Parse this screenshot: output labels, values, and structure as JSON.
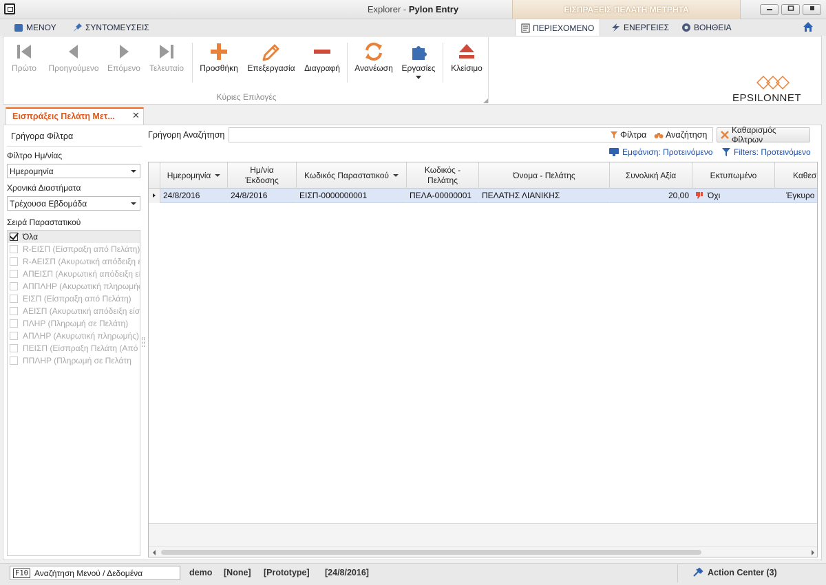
{
  "window": {
    "title_prefix": "Explorer - ",
    "title_app": "Pylon Entry",
    "context_title": "ΕΙΣΠΡΑΞΕΙΣ ΠΕΛΑΤΗ ΜΕΤΡΗΤΑ",
    "controls": [
      "minimize",
      "maximize",
      "close"
    ]
  },
  "menu": {
    "menu_label": "ΜΕΝΟΥ",
    "shortcuts_label": "ΣΥΝΤΟΜΕΥΣΕΙΣ",
    "tabs": {
      "content": "ΠΕΡΙΕΧΟΜΕΝΟ",
      "actions": "ΕΝΕΡΓΕΙΕΣ",
      "help": "ΒΟΗΘΕΙΑ"
    }
  },
  "ribbon": {
    "buttons": {
      "first": "Πρώτο",
      "previous": "Προηγούμενο",
      "next": "Επόμενο",
      "last": "Τελευταίο",
      "add": "Προσθήκη",
      "edit": "Επεξεργασία",
      "delete": "Διαγραφή",
      "refresh": "Ανανέωση",
      "tasks": "Εργασίες",
      "close": "Κλείσιμο"
    },
    "group_label": "Κύριες Επιλογές",
    "logo_text_a": "EPSILON",
    "logo_text_b": "NET",
    "accent": "#e8823a"
  },
  "doc_tab": {
    "label": "Εισπράξεις Πελάτη Μετ...",
    "close": "✕"
  },
  "left_panel": {
    "title": "Γρήγορα Φίλτρα",
    "date_filter_label": "Φίλτρο Ημ/νίας",
    "date_filter_value": "Ημερομηνία",
    "period_label": "Χρονικά Διαστήματα",
    "period_value": "Τρέχουσα Εβδομάδα",
    "series_label": "Σειρά Παραστατικού",
    "series": [
      "Όλα",
      "R-ΕΙΣΠ (Είσπραξη από Πελάτη)",
      "R-ΑΕΙΣΠ (Ακυρωτική απόδειξη είσπραξης)",
      "ΑΠΕΙΣΠ (Ακυρωτική απόδειξη είσπραξης)",
      "ΑΠΠΛΗΡ (Ακυρωτική πληρωμής)",
      "ΕΙΣΠ (Είσπραξη από Πελάτη)",
      "ΑΕΙΣΠ (Ακυρωτική απόδειξη είσπραξης)",
      "ΠΛΗΡ (Πληρωμή σε Πελάτη)",
      "ΑΠΛΗΡ (Ακυρωτική πληρωμής)",
      "ΠΕΙΣΠ (Είσπραξη Πελάτη (Από",
      "ΠΠΛΗΡ (Πληρωμή σε Πελάτη"
    ],
    "series_checked": [
      true,
      false,
      false,
      false,
      false,
      false,
      false,
      false,
      false,
      false,
      false
    ]
  },
  "search": {
    "label": "Γρήγορη Αναζήτηση",
    "value": "",
    "filters_label": "Φίλτρα",
    "search_label": "Αναζήτηση",
    "clear_label": "Καθαρισμός Φίλτρων",
    "view_label": "Εμφάνιση: Προτεινόμενο",
    "filters_view_label": "Filters: Προτεινόμενο"
  },
  "grid": {
    "columns": [
      "Ημερομηνία",
      "Ημ/νία\nΈκδοσης",
      "Κωδικός Παραστατικού",
      "Κωδικός -\nΠελάτης",
      "Όνομα - Πελάτης",
      "Συνολική Αξία",
      "Εκτυπωμένο",
      "Καθεσ"
    ],
    "rows": [
      [
        "24/8/2016",
        "24/8/2016",
        "ΕΙΣΠ-0000000001",
        "ΠΕΛΑ-00000001",
        "ΠΕΛΑΤΗΣ ΛΙΑΝΙΚΗΣ",
        "20,00",
        "Όχι",
        "Έγκυρο"
      ]
    ]
  },
  "status": {
    "f10_key": "F10",
    "f10_label": "Αναζήτηση Μενού / Δεδομένα",
    "user": "demo",
    "company": "[None]",
    "env": "[Prototype]",
    "date": "[24/8/2016]",
    "action_center": "Action Center (3)"
  }
}
